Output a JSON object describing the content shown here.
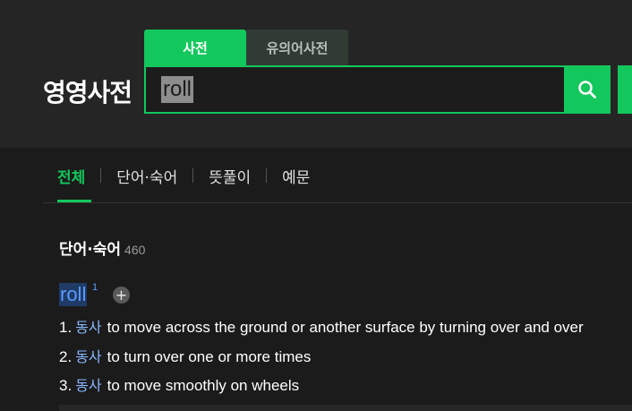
{
  "brand": {
    "title": "영영사전"
  },
  "tabs": {
    "dictionary": "사전",
    "synonyms": "유의어사전"
  },
  "search": {
    "query": "roll"
  },
  "filter_tabs": [
    {
      "label": "전체",
      "active": true
    },
    {
      "label": "단어·숙어",
      "active": false
    },
    {
      "label": "뜻풀이",
      "active": false
    },
    {
      "label": "예문",
      "active": false
    }
  ],
  "section": {
    "title": "단어·숙어",
    "count": "460"
  },
  "entry": {
    "word": "roll",
    "superscript": "1",
    "add_label": "+",
    "definitions": [
      {
        "num": "1.",
        "pos": "동사",
        "text": "to move across the ground or another surface by turning over and over"
      },
      {
        "num": "2.",
        "pos": "동사",
        "text": "to turn over one or more times"
      },
      {
        "num": "3.",
        "pos": "동사",
        "text": "to move smoothly on wheels"
      }
    ]
  },
  "colors": {
    "accent": "#12c75c",
    "link": "#5b9bff"
  }
}
